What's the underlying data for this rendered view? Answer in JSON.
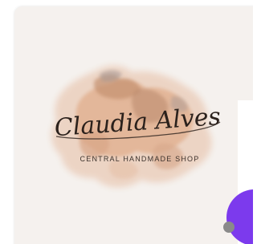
{
  "logo": {
    "name": "Claudia Alves",
    "tagline": "CENTRAL HANDMADE SHOP"
  },
  "colors": {
    "card_background": "#f5f1ee",
    "accent": "#7c3aed",
    "script_ink": "#2b211c",
    "tagline_ink": "#3d322c",
    "watercolor_peach": "#e8bfa3",
    "watercolor_brown": "#c4916f",
    "watercolor_gray": "#a99a95"
  },
  "icons": {
    "floating_button": "purple-circle-icon"
  }
}
